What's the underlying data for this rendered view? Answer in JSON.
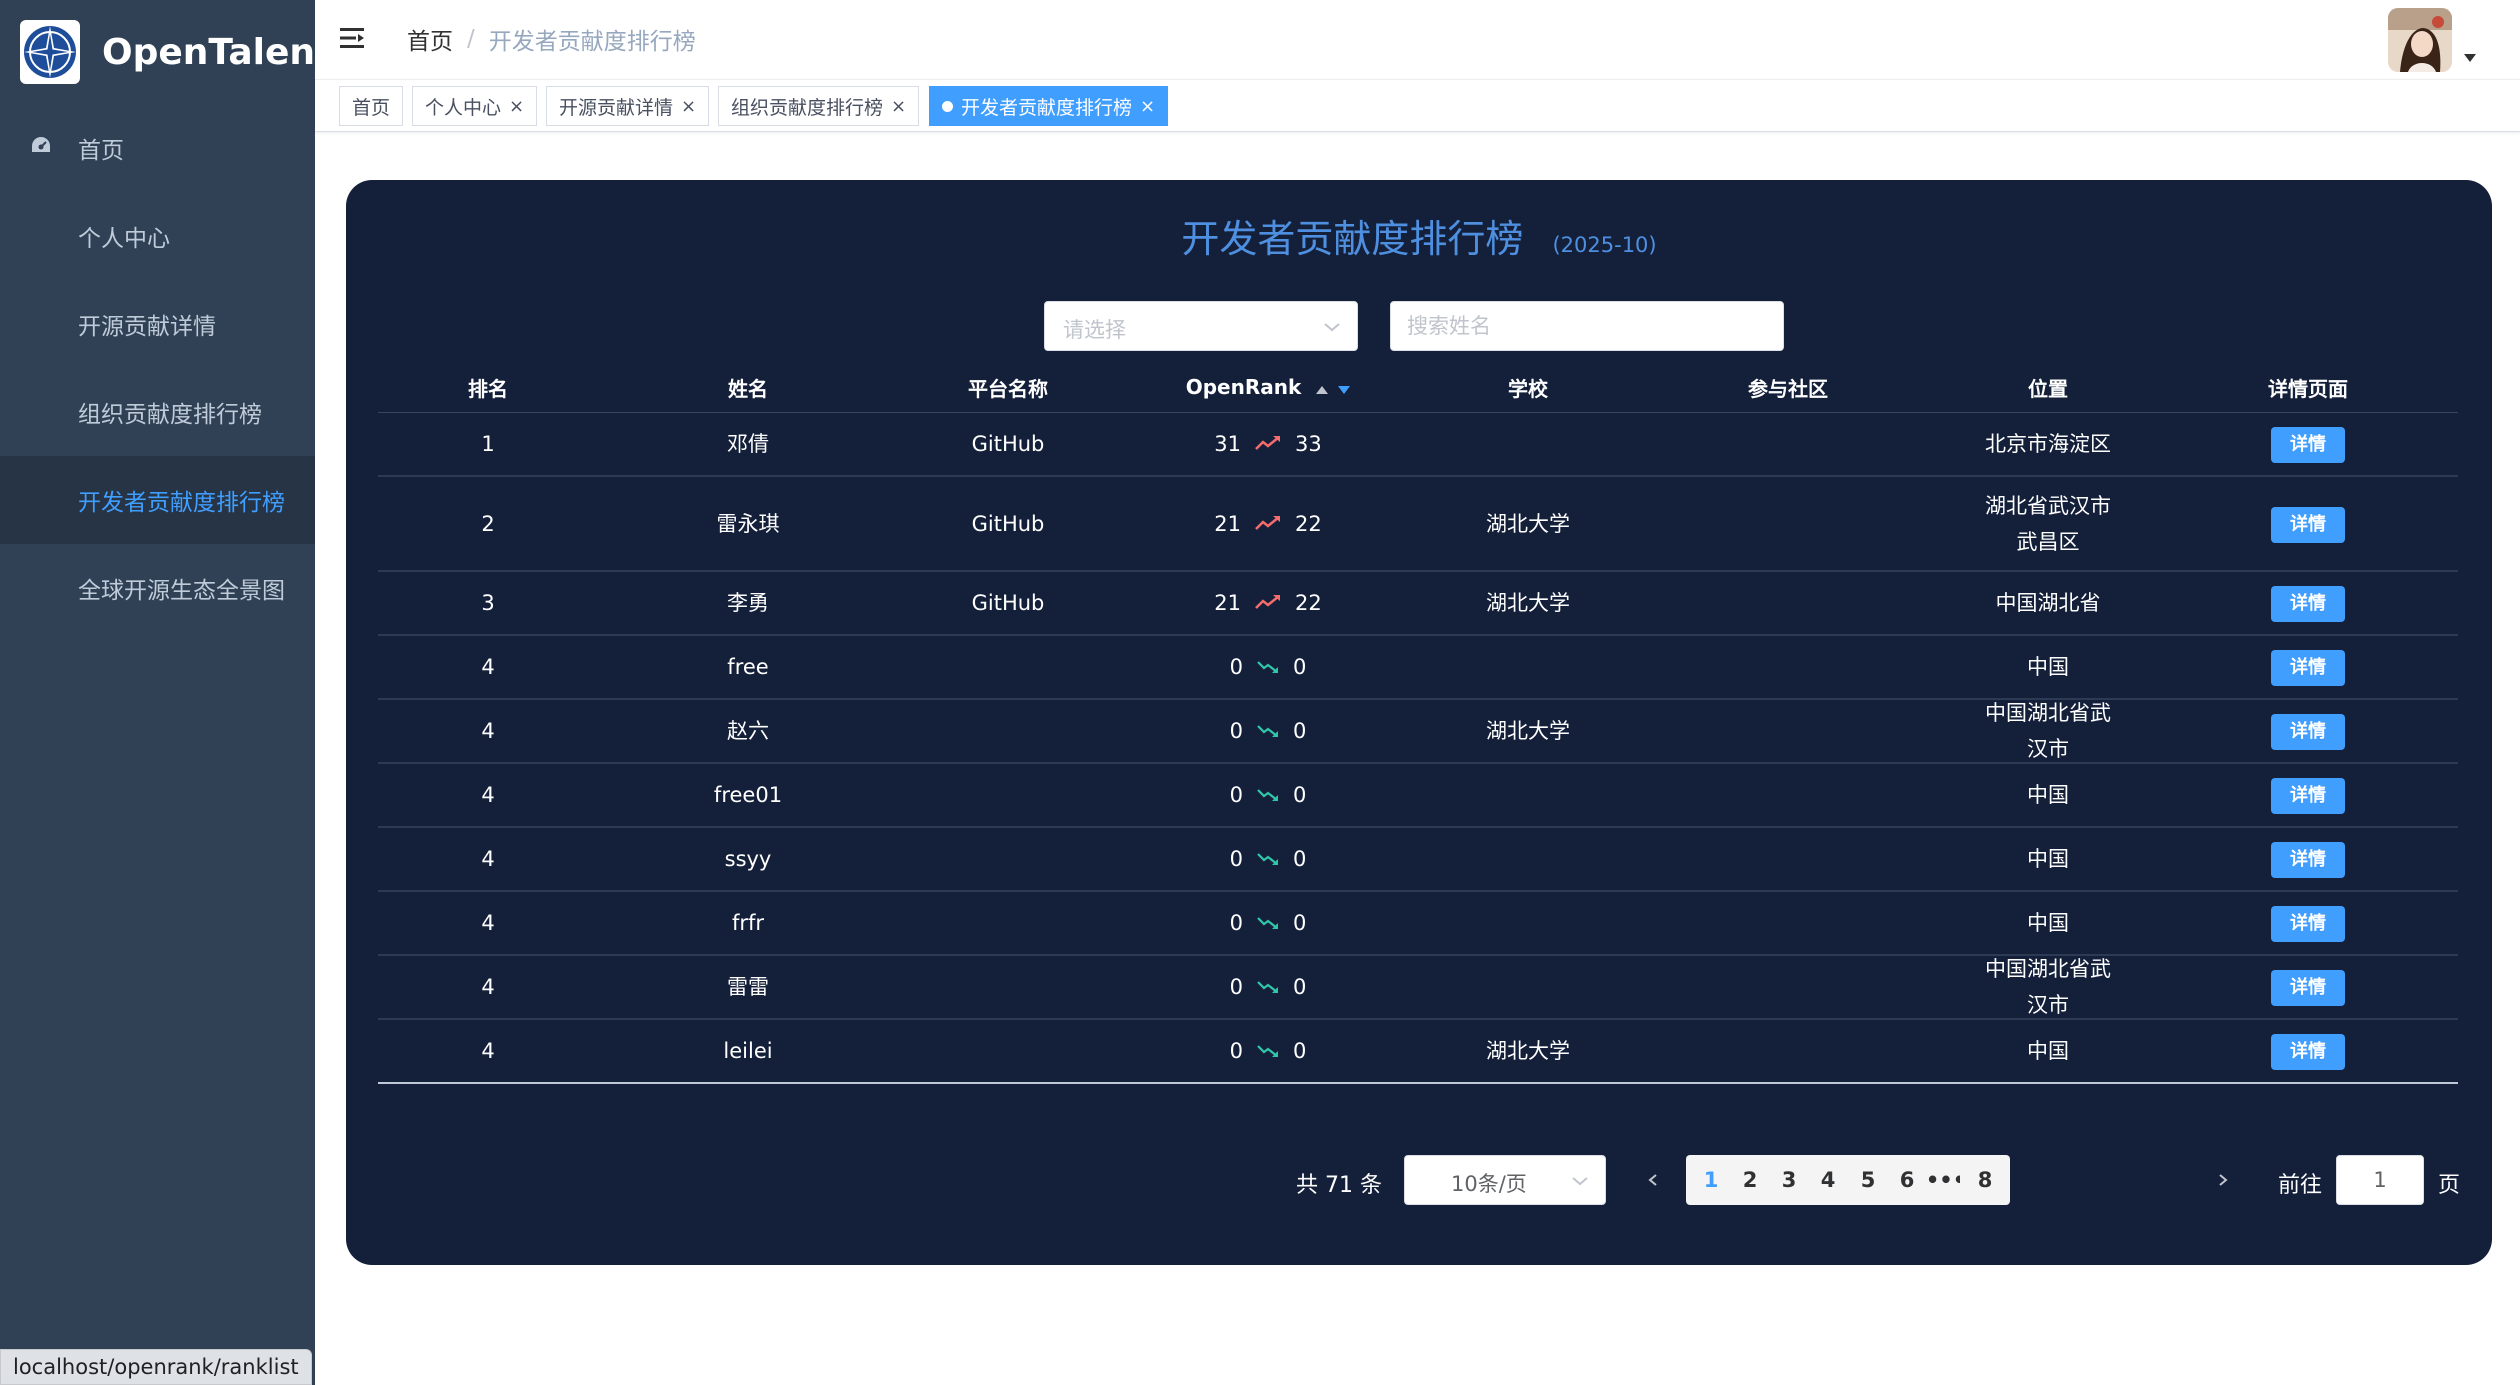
{
  "sidebar": {
    "logo_text": "OpenTalent",
    "items": [
      {
        "label": "首页"
      },
      {
        "label": "个人中心"
      },
      {
        "label": "开源贡献详情"
      },
      {
        "label": "组织贡献度排行榜"
      },
      {
        "label": "开发者贡献度排行榜"
      },
      {
        "label": "全球开源生态全景图"
      }
    ],
    "active_index": 4
  },
  "status_bar": {
    "url": "localhost/openrank/ranklist"
  },
  "navbar": {
    "breadcrumb": {
      "home": "首页",
      "separator": "/",
      "current": "开发者贡献度排行榜"
    }
  },
  "tags": [
    {
      "label": "首页",
      "closable": false
    },
    {
      "label": "个人中心",
      "closable": true
    },
    {
      "label": "开源贡献详情",
      "closable": true
    },
    {
      "label": "组织贡献度排行榜",
      "closable": true
    },
    {
      "label": "开发者贡献度排行榜",
      "closable": true,
      "active": true
    }
  ],
  "page": {
    "title": "开发者贡献度排行榜",
    "subtitle": "(2025-10)",
    "select_placeholder": "请选择",
    "search_placeholder": "搜索姓名"
  },
  "table": {
    "columns": [
      "排名",
      "姓名",
      "平台名称",
      "OpenRank",
      "学校",
      "参与社区",
      "位置",
      "详情页面"
    ],
    "rows": [
      {
        "rank": "1",
        "name": "邓倩",
        "platform": "GitHub",
        "prev": "31",
        "curr": "33",
        "trend": "up",
        "school": "",
        "community": "",
        "location": "北京市海淀区",
        "action": "详情"
      },
      {
        "rank": "2",
        "name": "雷永琪",
        "platform": "GitHub",
        "prev": "21",
        "curr": "22",
        "trend": "up",
        "school": "湖北大学",
        "community": "",
        "location": "湖北省武汉市武昌区",
        "action": "详情"
      },
      {
        "rank": "3",
        "name": "李勇",
        "platform": "GitHub",
        "prev": "21",
        "curr": "22",
        "trend": "up",
        "school": "湖北大学",
        "community": "",
        "location": "中国湖北省",
        "action": "详情"
      },
      {
        "rank": "4",
        "name": "free",
        "platform": "",
        "prev": "0",
        "curr": "0",
        "trend": "down",
        "school": "",
        "community": "",
        "location": "中国",
        "action": "详情"
      },
      {
        "rank": "4",
        "name": "赵六",
        "platform": "",
        "prev": "0",
        "curr": "0",
        "trend": "down",
        "school": "湖北大学",
        "community": "",
        "location": "中国湖北省武汉市",
        "action": "详情"
      },
      {
        "rank": "4",
        "name": "free01",
        "platform": "",
        "prev": "0",
        "curr": "0",
        "trend": "down",
        "school": "",
        "community": "",
        "location": "中国",
        "action": "详情"
      },
      {
        "rank": "4",
        "name": "ssyy",
        "platform": "",
        "prev": "0",
        "curr": "0",
        "trend": "down",
        "school": "",
        "community": "",
        "location": "中国",
        "action": "详情"
      },
      {
        "rank": "4",
        "name": "frfr",
        "platform": "",
        "prev": "0",
        "curr": "0",
        "trend": "down",
        "school": "",
        "community": "",
        "location": "中国",
        "action": "详情"
      },
      {
        "rank": "4",
        "name": "雷雷",
        "platform": "",
        "prev": "0",
        "curr": "0",
        "trend": "down",
        "school": "",
        "community": "",
        "location": "中国湖北省武汉市",
        "action": "详情"
      },
      {
        "rank": "4",
        "name": "leilei",
        "platform": "",
        "prev": "0",
        "curr": "0",
        "trend": "down",
        "school": "湖北大学",
        "community": "",
        "location": "中国",
        "action": "详情"
      }
    ]
  },
  "pagination": {
    "total_text": "共 71 条",
    "page_size": "10条/页",
    "pages": [
      "1",
      "2",
      "3",
      "4",
      "5",
      "6",
      "•••",
      "8"
    ],
    "current_page": "1",
    "goto_label": "前往",
    "goto_value": "1",
    "page_suffix": "页"
  },
  "colors": {
    "sidebar_bg": "#304156",
    "sidebar_active_text": "#409eff",
    "card_bg": "#14203a",
    "accent": "#409eff",
    "trend_up": "#f56c6c",
    "trend_down": "#2ec7a8"
  }
}
